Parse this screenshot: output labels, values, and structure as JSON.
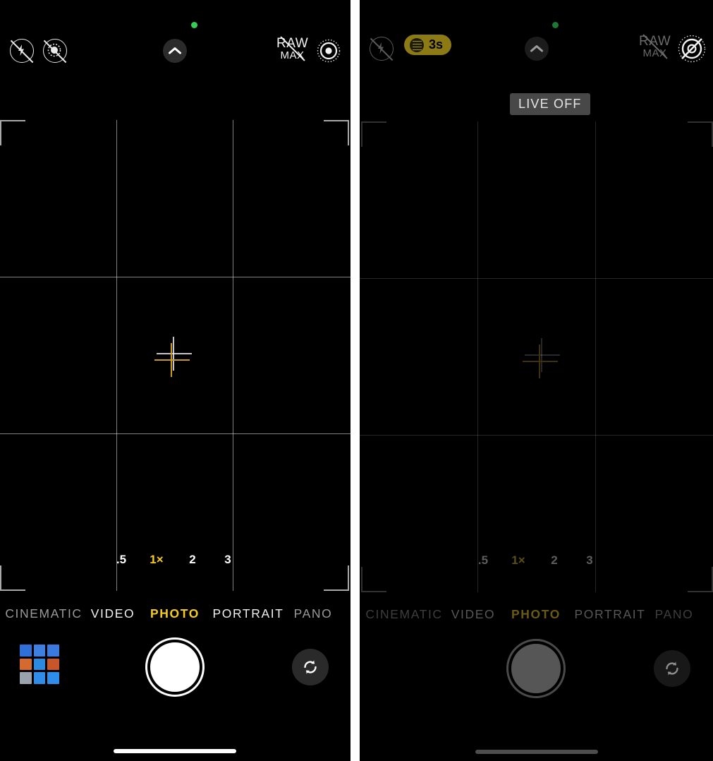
{
  "app": {
    "name": "Camera",
    "panels": [
      {
        "id": "left",
        "label": "Live Photo on, Night mode off"
      },
      {
        "id": "right",
        "label": "Live Photo off, Night mode 3s"
      }
    ]
  },
  "left_panel": {
    "topbar": {
      "flash_icon": "flash-off-icon",
      "live_photo_toggle_icon": "live-photo-off-icon",
      "chevron_icon": "chevron-up-icon",
      "raw_line1": "RAW",
      "raw_line2": "MAX",
      "raw_icon": "raw-max-off-icon",
      "live_photo_status_icon": "live-photo-on-icon"
    },
    "viewfinder": {
      "level_icon": "level-crosshair-icon",
      "grid": "rule-of-thirds"
    },
    "zoom": {
      "options": [
        {
          "label": ".5",
          "selected": false
        },
        {
          "label": "1×",
          "selected": true
        },
        {
          "label": "2",
          "selected": false
        },
        {
          "label": "3",
          "selected": false
        }
      ]
    },
    "modes": [
      {
        "label": "CINEMATIC",
        "selected": false,
        "dim": true
      },
      {
        "label": "VIDEO",
        "selected": false,
        "dim": false
      },
      {
        "label": "PHOTO",
        "selected": true,
        "dim": false
      },
      {
        "label": "PORTRAIT",
        "selected": false,
        "dim": false
      },
      {
        "label": "PANO",
        "selected": false,
        "dim": true
      }
    ],
    "bottom": {
      "thumbnail_name": "photo-library-thumbnail",
      "shutter_name": "shutter-button",
      "flip_name": "camera-flip-button",
      "flip_icon": "camera-flip-icon"
    }
  },
  "right_panel": {
    "topbar": {
      "flash_icon": "flash-off-icon",
      "night_mode_label": "3s",
      "night_mode_icon": "night-mode-icon",
      "chevron_icon": "chevron-up-icon",
      "raw_line1": "RAW",
      "raw_line2": "MAX",
      "raw_icon": "raw-max-off-icon",
      "live_photo_status_icon": "live-photo-off-icon"
    },
    "live_badge": "LIVE OFF",
    "viewfinder": {
      "level_icon": "level-crosshair-icon",
      "grid": "rule-of-thirds"
    },
    "zoom": {
      "options": [
        {
          "label": ".5",
          "selected": false
        },
        {
          "label": "1×",
          "selected": true
        },
        {
          "label": "2",
          "selected": false
        },
        {
          "label": "3",
          "selected": false
        }
      ]
    },
    "modes": [
      {
        "label": "CINEMATIC",
        "selected": false,
        "dim": true
      },
      {
        "label": "VIDEO",
        "selected": false,
        "dim": false
      },
      {
        "label": "PHOTO",
        "selected": true,
        "dim": false
      },
      {
        "label": "PORTRAIT",
        "selected": false,
        "dim": false
      },
      {
        "label": "PANO",
        "selected": false,
        "dim": true
      }
    ],
    "bottom": {
      "shutter_name": "shutter-button",
      "flip_name": "camera-flip-button",
      "flip_icon": "camera-flip-icon"
    }
  },
  "colors": {
    "accent_yellow": "#f5cb20",
    "night_pill": "#8c7a15",
    "recording_dot_green": "#31d158",
    "background": "#000000",
    "badge_gray": "#484848"
  }
}
